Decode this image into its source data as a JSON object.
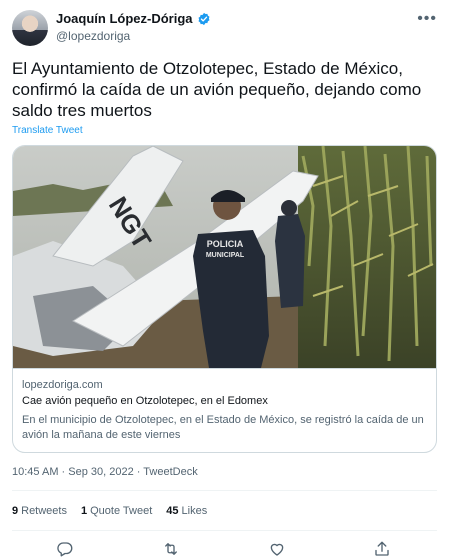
{
  "author": {
    "name": "Joaquín López-Dóriga",
    "handle": "@lopezdoriga"
  },
  "tweet": {
    "text": "El Ayuntamiento de Otzolotepec, Estado de México, confirmó la caída de un avión pequeño, dejando como saldo tres muertos",
    "translate_label": "Translate Tweet"
  },
  "card": {
    "image_overlay": {
      "aircraft_marking": "NGT",
      "vest_line1": "POLICIA",
      "vest_line2": "MUNICIPAL"
    },
    "domain": "lopezdoriga.com",
    "title": "Cae avión pequeño en Otzolotepec, en el Edomex",
    "description": "En el municipio de Otzolotepec, en el Estado de México, se registró la caída de un avión la mañana de este viernes"
  },
  "meta": {
    "time": "10:45 AM",
    "date": "Sep 30, 2022",
    "source": "TweetDeck",
    "separator": " · "
  },
  "stats": {
    "retweets_count": "9",
    "retweets_label": "Retweets",
    "quotes_count": "1",
    "quotes_label": "Quote Tweet",
    "likes_count": "45",
    "likes_label": "Likes"
  },
  "icons": {
    "verified": "verified-badge-icon",
    "more": "more-dots-icon",
    "reply": "reply-icon",
    "retweet": "retweet-icon",
    "like": "heart-icon",
    "share": "share-icon"
  },
  "colors": {
    "accent": "#1d9bf0",
    "text": "#0f1419",
    "secondary": "#536471",
    "border": "#cfd9de"
  }
}
